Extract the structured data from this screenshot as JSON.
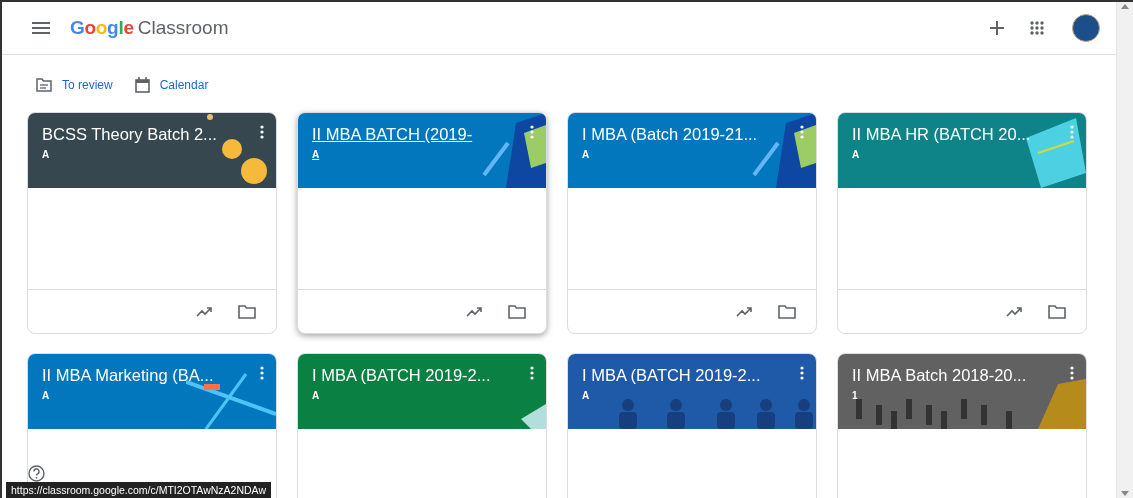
{
  "app_bar": {
    "logo_word": "Google",
    "product": "Classroom"
  },
  "quick_links": [
    {
      "kind": "review",
      "label": "To review"
    },
    {
      "kind": "calendar",
      "label": "Calendar"
    }
  ],
  "classes": [
    {
      "title": "BCSS Theory Batch 2...",
      "section": "A",
      "color": "#37474f",
      "kind": "coins",
      "hovered": false
    },
    {
      "title": "II MBA BATCH (2019-",
      "section": "A",
      "color": "#0277bd",
      "kind": "pencil",
      "hovered": true
    },
    {
      "title": "I MBA (Batch 2019-21...",
      "section": "A",
      "color": "#0277bd",
      "kind": "pencil",
      "hovered": false
    },
    {
      "title": "II MBA HR (BATCH 20...",
      "section": "A",
      "color": "#0e8388",
      "kind": "paper",
      "hovered": false
    },
    {
      "title": "II MBA Marketing (BA...",
      "section": "A",
      "color": "#0277bd",
      "kind": "rods",
      "hovered": false
    },
    {
      "title": "I MBA (BATCH 2019-2...",
      "section": "A",
      "color": "#0b8043",
      "kind": "stripes",
      "hovered": false
    },
    {
      "title": "I MBA (BATCH 2019-2...",
      "section": "A",
      "color": "#1e5aa8",
      "kind": "people",
      "hovered": false
    },
    {
      "title": "II MBA Batch 2018-20...",
      "section": "1",
      "color": "#616161",
      "kind": "crowd",
      "hovered": false
    }
  ],
  "status_url": "https://classroom.google.com/c/MTI2OTAwNzA2NDAw"
}
